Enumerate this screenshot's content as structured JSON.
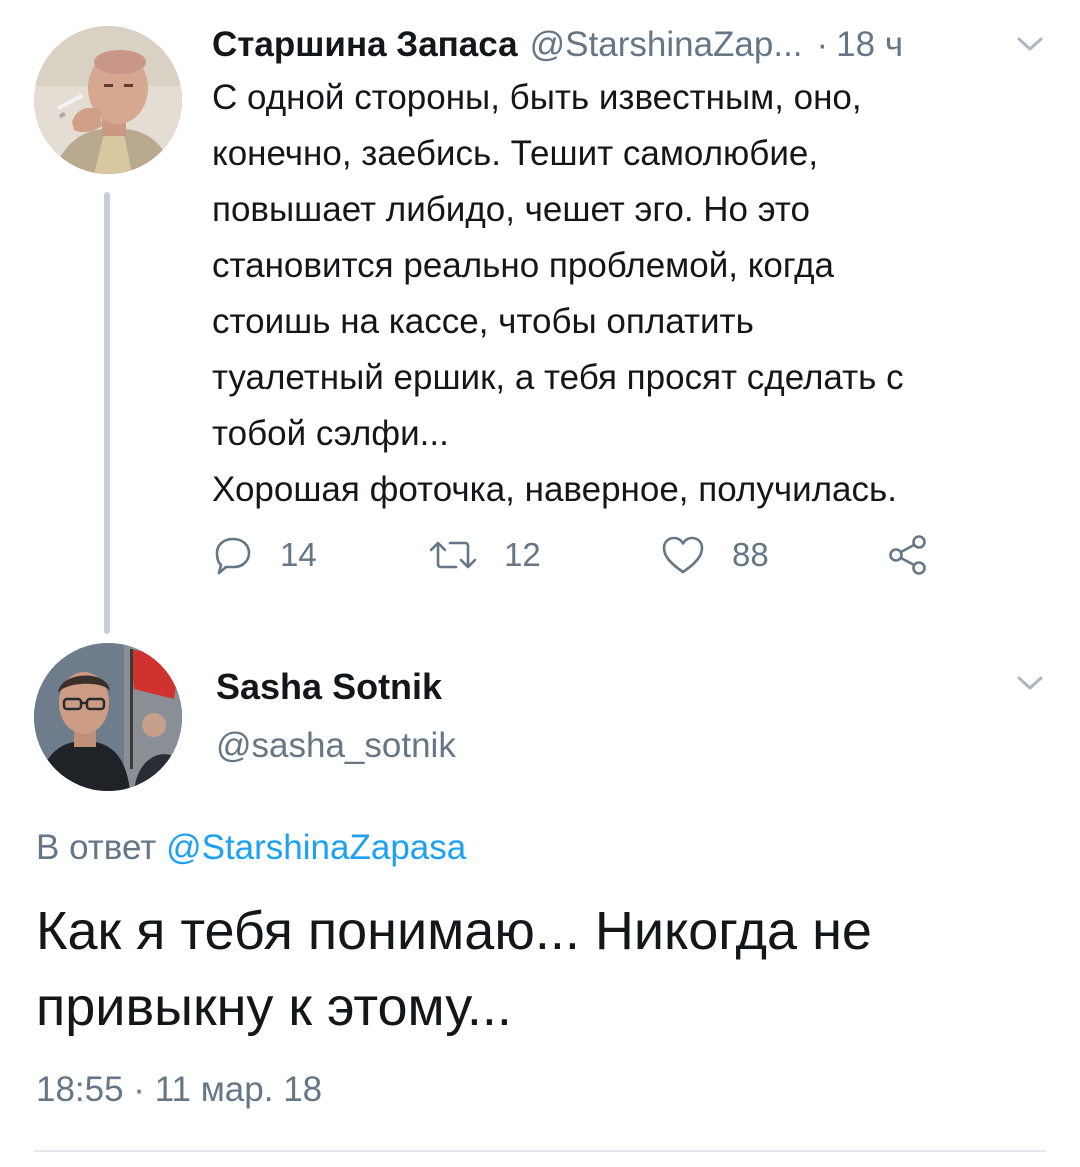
{
  "parent_tweet": {
    "author_name": "Старшина Запаса",
    "author_handle": "@StarshinaZap...",
    "separator": "·",
    "time": "18 ч",
    "text": "С одной стороны, быть известным, оно,\nконечно, заебись. Тешит самолюбие,\nповышает либидо, чешет эго. Но это\nстановится реально проблемой, когда\nстоишь на кассе, чтобы оплатить\nтуалетный ершик, а тебя просят сделать с\nтобой сэлфи...\nХорошая фоточка, наверное, получилась.",
    "actions": {
      "reply_count": "14",
      "retweet_count": "12",
      "like_count": "88"
    }
  },
  "reply_tweet": {
    "author_name": "Sasha Sotnik",
    "author_handle": "@sasha_sotnik",
    "reply_to_label": "В ответ",
    "reply_to_mention": "@StarshinaZapasa",
    "text": "Как я тебя понимаю... Никогда не\nпривыкну к этому...",
    "timestamp": "18:55 · 11 мар. 18"
  },
  "colors": {
    "text_primary": "#14171a",
    "text_secondary": "#657786",
    "link": "#1da1f2",
    "thread_line": "#c4cfd6",
    "divider": "#e1e8ed"
  },
  "icons": {
    "reply": "reply-icon",
    "retweet": "retweet-icon",
    "like": "heart-icon",
    "share": "share-icon",
    "menu": "chevron-down-icon"
  }
}
